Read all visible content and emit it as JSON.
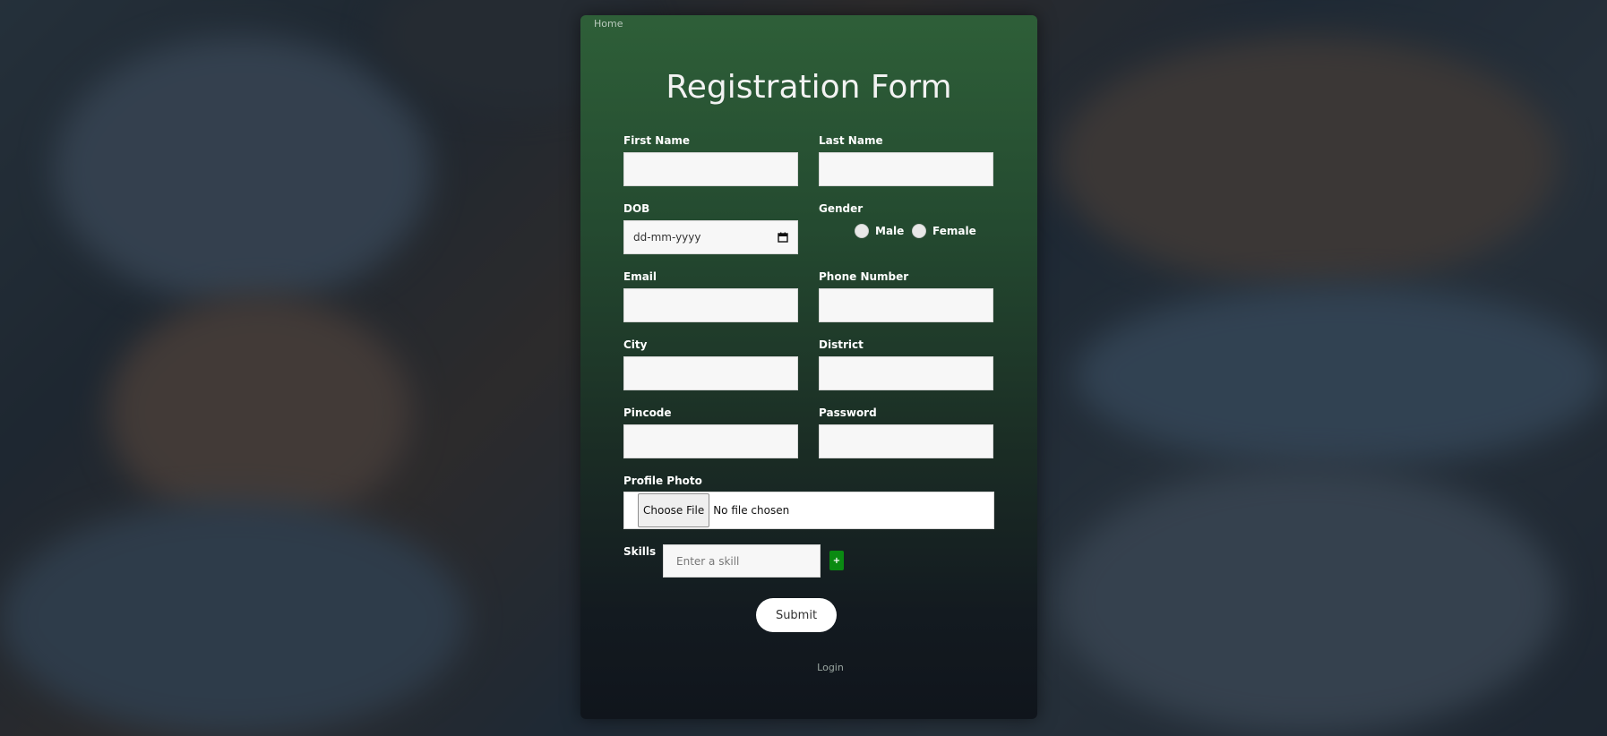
{
  "nav": {
    "home_label": "Home",
    "login_label": "Login"
  },
  "form": {
    "title": "Registration Form",
    "first_name_label": "First Name",
    "last_name_label": "Last Name",
    "dob_label": "DOB",
    "dob_placeholder": "dd-mm-yyyy",
    "gender_label": "Gender",
    "gender_options": [
      "Male",
      "Female"
    ],
    "email_label": "Email",
    "phone_label": "Phone Number",
    "city_label": "City",
    "district_label": "District",
    "pincode_label": "Pincode",
    "password_label": "Password",
    "profile_photo_label": "Profile Photo",
    "choose_file_label": "Choose File",
    "file_status": "No file chosen",
    "skills_label": "Skills",
    "skill_placeholder": "Enter a skill",
    "add_skill_label": "+",
    "submit_label": "Submit"
  },
  "colors": {
    "card_top": "#2e5f38",
    "card_bottom": "#10151c",
    "add_button": "#0a8a12"
  }
}
